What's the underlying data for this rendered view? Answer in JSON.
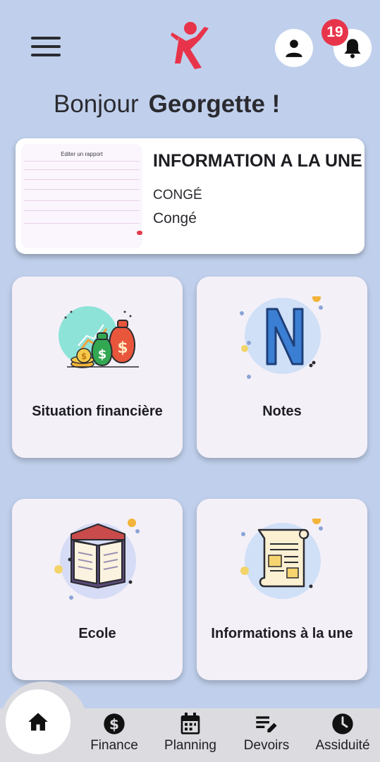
{
  "header": {
    "menu_icon": "menu-icon",
    "logo_icon": "running-figure-logo",
    "profile_icon": "person-icon",
    "notification_icon": "bell-icon",
    "notification_count": "19"
  },
  "greeting": {
    "hello": "Bonjour",
    "name": "Georgette !"
  },
  "featured": {
    "thumbnail_title": "Editer un rapport",
    "headline": "INFORMATION A LA UNE",
    "category": "CONGÉ",
    "description": "Congé"
  },
  "tiles": [
    {
      "label": "Situation financière",
      "icon": "money-bags-icon"
    },
    {
      "label": "Notes",
      "icon": "letter-n-icon"
    },
    {
      "label": "Ecole",
      "icon": "open-book-icon"
    },
    {
      "label": "Informations à la une",
      "icon": "newspaper-icon"
    }
  ],
  "bottom_nav": {
    "home_icon": "home-icon",
    "items": [
      {
        "label": "Finance",
        "icon": "dollar-icon"
      },
      {
        "label": "Planning",
        "icon": "calendar-icon"
      },
      {
        "label": "Devoirs",
        "icon": "edit-list-icon"
      },
      {
        "label": "Assiduité",
        "icon": "clock-icon"
      }
    ]
  },
  "colors": {
    "background": "#c0d0ec",
    "accent_red": "#e8344b",
    "card": "#f4f0f8"
  }
}
